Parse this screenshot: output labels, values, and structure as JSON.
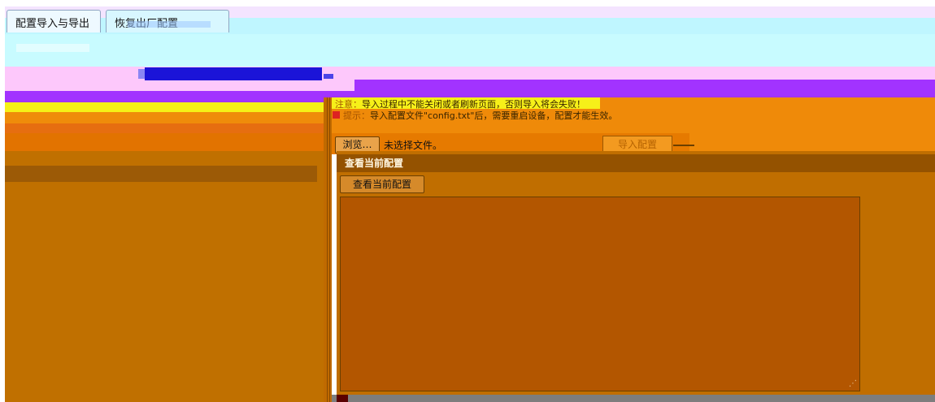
{
  "tabs": [
    {
      "label": "配置导入与导出"
    },
    {
      "label": "恢复出厂配置"
    }
  ],
  "import": {
    "notice_label": "注意：",
    "notice_text": "导入过程中不能关闭或者刷新页面，否则导入将会失败！",
    "hint_label": "提示：",
    "hint_text": "导入配置文件\"config.txt\"后，需要重启设备，配置才能生效。",
    "browse_label": "浏览…",
    "file_status": "未选择文件。",
    "import_button": "导入配置"
  },
  "view": {
    "section_title": "查看当前配置",
    "button": "查看当前配置",
    "config_text": ""
  }
}
